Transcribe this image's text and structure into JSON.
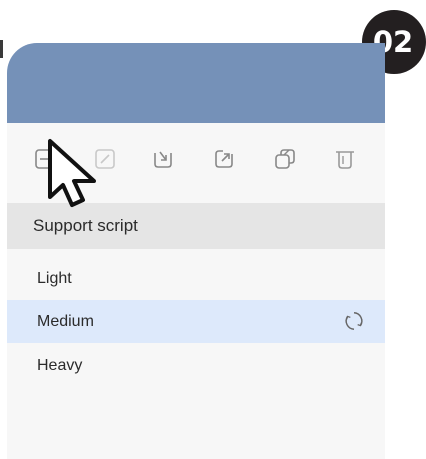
{
  "step_badge": {
    "label": "02"
  },
  "toolbar": {
    "buttons": [
      {
        "icon": "collapse-icon"
      },
      {
        "icon": "edit-icon"
      },
      {
        "icon": "import-icon"
      },
      {
        "icon": "export-icon"
      },
      {
        "icon": "duplicate-icon"
      },
      {
        "icon": "trash-icon"
      }
    ]
  },
  "section": {
    "title": "Support script"
  },
  "options": [
    {
      "label": "Light",
      "selected": false
    },
    {
      "label": "Medium",
      "selected": true,
      "indicator": "refresh-icon"
    },
    {
      "label": "Heavy",
      "selected": false
    }
  ],
  "colors": {
    "header": "#7591b8",
    "selected_row": "#dde9fb",
    "section_header": "#e5e5e5",
    "badge": "#231f20"
  }
}
